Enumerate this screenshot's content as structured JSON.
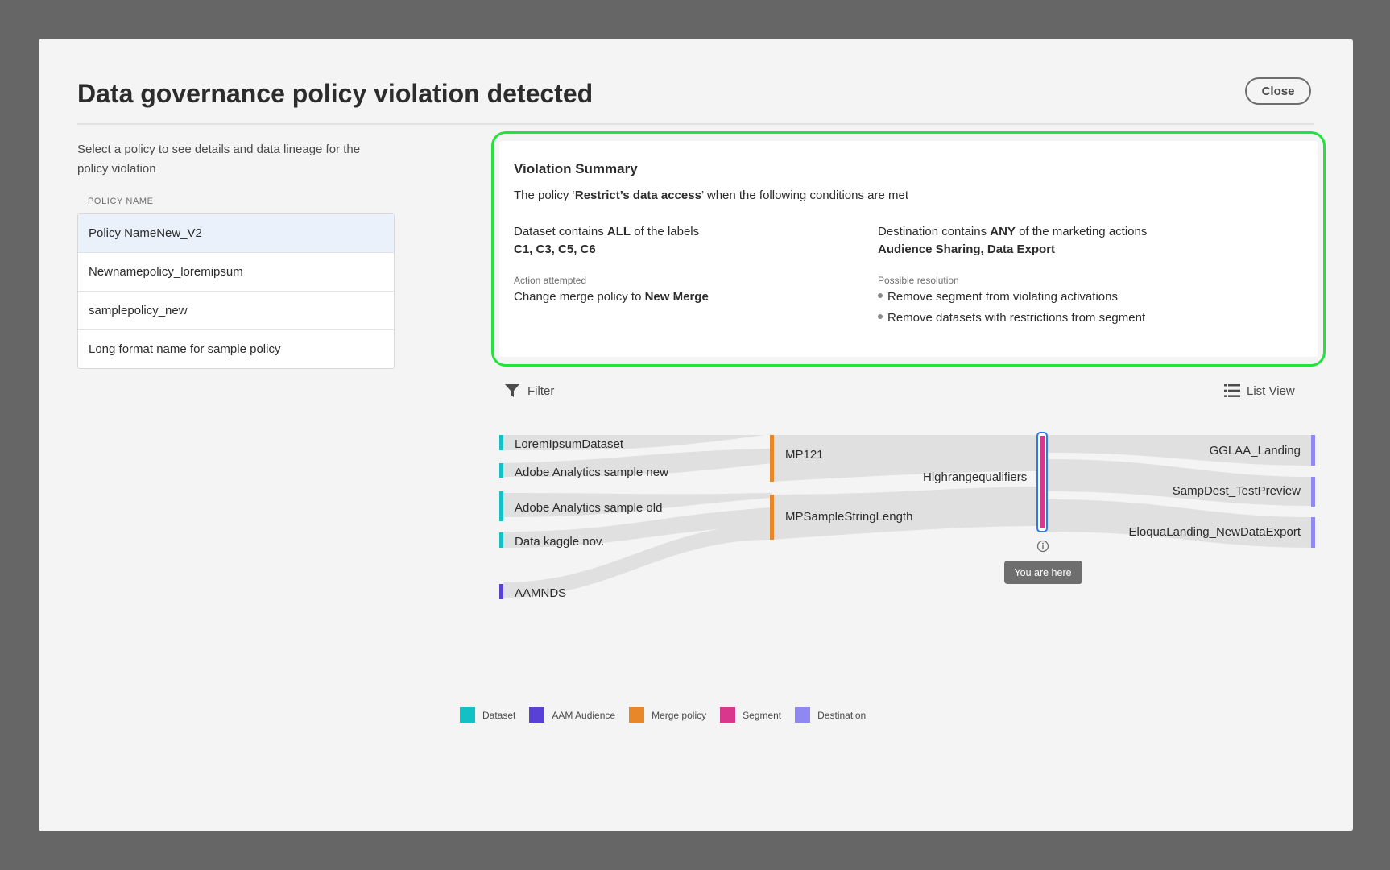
{
  "dialog": {
    "title": "Data governance policy violation detected",
    "close_label": "Close"
  },
  "sidebar": {
    "intro": "Select a policy to see details and data lineage for the policy violation",
    "column_header": "POLICY NAME",
    "policies": [
      {
        "label": "Policy NameNew_V2",
        "selected": true
      },
      {
        "label": "Newnamepolicy_loremipsum",
        "selected": false
      },
      {
        "label": "samplepolicy_new",
        "selected": false
      },
      {
        "label": "Long format name for sample policy",
        "selected": false
      }
    ]
  },
  "summary": {
    "title": "Violation Summary",
    "desc_prefix": "The policy ‘",
    "policy_name": "Restrict’s data access",
    "desc_suffix": "’ when the following conditions are met",
    "dataset_prefix": "Dataset contains ",
    "dataset_quantifier": "ALL",
    "dataset_suffix": " of the labels",
    "labels": "C1, C3, C5, C6",
    "destination_prefix": "Destination contains ",
    "destination_quantifier": "ANY",
    "destination_suffix": " of the marketing actions",
    "marketing_actions": "Audience Sharing,  Data Export",
    "action_heading": "Action attempted",
    "action_prefix": "Change merge policy to ",
    "action_target": "New Merge",
    "resolution_heading": "Possible resolution",
    "resolutions": [
      "Remove segment from violating activations",
      "Remove datasets with restrictions from segment"
    ]
  },
  "toolbar": {
    "filter_label": "Filter",
    "list_view_label": "List View"
  },
  "lineage": {
    "sources": [
      {
        "label": "LoremIpsumDataset",
        "type": "Dataset"
      },
      {
        "label": "Adobe Analytics sample new",
        "type": "Dataset"
      },
      {
        "label": "Adobe Analytics sample old",
        "type": "Dataset"
      },
      {
        "label": "Data kaggle nov.",
        "type": "Dataset"
      },
      {
        "label": "AAMNDS",
        "type": "AAM Audience"
      }
    ],
    "merge_policies": [
      {
        "label": "MP121",
        "type": "Merge policy"
      },
      {
        "label": "MPSampleStringLength",
        "type": "Merge policy"
      }
    ],
    "segment": {
      "label": "Highrangequalifiers",
      "type": "Segment"
    },
    "destinations": [
      {
        "label": "GGLAA_Landing",
        "type": "Destination"
      },
      {
        "label": "SampDest_TestPreview",
        "type": "Destination"
      },
      {
        "label": "EloquaLanding_NewDataExport",
        "type": "Destination"
      }
    ],
    "tooltip": "You are here",
    "info_icon": "info-icon"
  },
  "legend": [
    {
      "label": "Dataset",
      "color": "#13c0c6"
    },
    {
      "label": "AAM Audience",
      "color": "#5a41d5"
    },
    {
      "label": "Merge policy",
      "color": "#e8862a"
    },
    {
      "label": "Segment",
      "color": "#d9378e"
    },
    {
      "label": "Destination",
      "color": "#8f87f2"
    }
  ],
  "colors": {
    "dataset": "#13c0c6",
    "aam_audience": "#5a41d5",
    "merge_policy": "#e8862a",
    "segment": "#d9378e",
    "destination": "#8f87f2",
    "highlight_outline": "#22e339",
    "selection_ring": "#2b7be4"
  }
}
